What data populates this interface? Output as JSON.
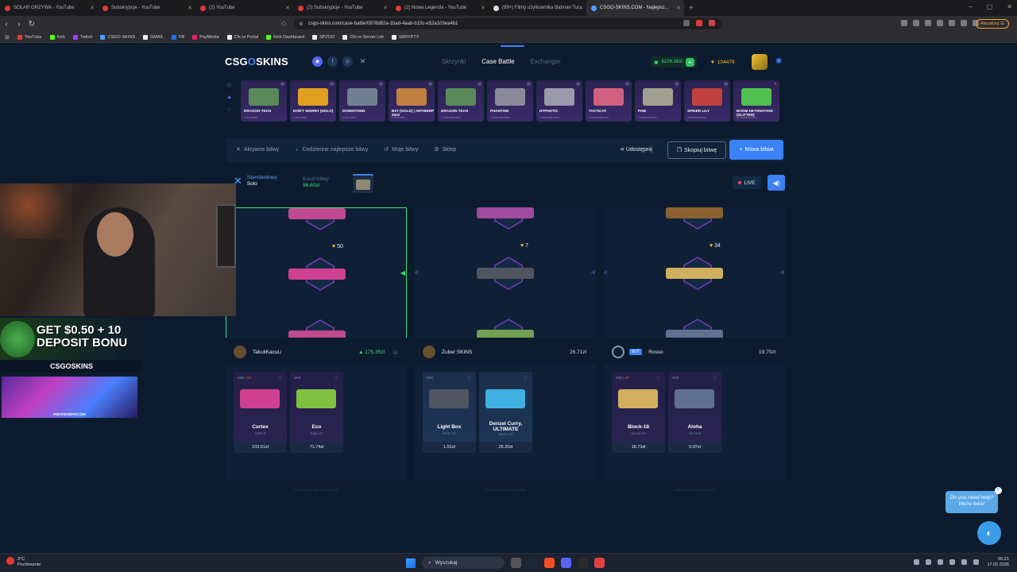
{
  "browser": {
    "tabs": [
      {
        "title": "SOLAR GRZYWA - YouTube",
        "icon": "youtube-icon",
        "active": false
      },
      {
        "title": "Subskrypcje - YouTube",
        "icon": "youtube-icon",
        "active": false
      },
      {
        "title": "(2) YouTube",
        "icon": "youtube-icon",
        "active": false
      },
      {
        "title": "(2) Subskrypcje - YouTube",
        "icon": "youtube-icon",
        "active": false
      },
      {
        "title": "(2) Nowa Legenda - YouTube",
        "icon": "youtube-icon",
        "active": false
      },
      {
        "title": "(99+) Filmy użytkownika Batman Tur...",
        "icon": "github-icon",
        "active": false
      },
      {
        "title": "CSGO-SKINS.COM - Najlepsz...",
        "icon": "csgo-skins-icon",
        "active": true
      }
    ],
    "url": "csgo-skins.com/case-battle/0978d82a-1bad-4aab-b15c-e52a103ea4b1",
    "update_label": "Aktualizuj",
    "bookmarks": [
      "YouTube",
      "Kick",
      "Twitch",
      "CSGO-SKINS",
      "GMAIL",
      "FB",
      "PayMedia",
      "Cfx.re Portal",
      "Kick Dashboard",
      "SPZOO",
      "Cfx.re Server List",
      "SKRYPTY"
    ]
  },
  "site": {
    "logo_left": "CSG",
    "logo_o": "O",
    "logo_right": "SKINS",
    "nav": {
      "cases": "Skrzynki",
      "battle": "Case Battle",
      "exchanger": "Exchanger"
    },
    "balance": "6226.16zł",
    "coins": "104479"
  },
  "drops": [
    {
      "name": "DRAGON TECH",
      "sub": "u tej chwili",
      "color": "#5a8a5a"
    },
    {
      "name": "DON'T WORRY (HOLO)",
      "sub": "u tej chwili",
      "color": "#e0a020"
    },
    {
      "name": "DOWNTOWN",
      "sub": "u tej chwili",
      "color": "#708090"
    },
    {
      "name": "B1T (GOLD) | ANTWERP 2022",
      "sub": "u tej chwili",
      "color": "#c08040"
    },
    {
      "name": "DRAGON TECH",
      "sub": "1 sekundy temu",
      "color": "#5a8a5a"
    },
    {
      "name": "PHANTOM",
      "sub": "3 sekundy temu",
      "color": "#8a8a9a"
    },
    {
      "name": "HYPNOTIC",
      "sub": "3 sekundy temu",
      "color": "#9a9aaa"
    },
    {
      "name": "TACTICAT",
      "sub": "4 sekundy temu",
      "color": "#d06080"
    },
    {
      "name": "PAW",
      "sub": "7 sekund temu",
      "color": "#a0a090"
    },
    {
      "name": "SPIDER LILY",
      "sub": "9 sekund temu",
      "color": "#c04040"
    },
    {
      "name": "BOOM DETONATION (GLITTER)",
      "sub": "12 sekund temu",
      "color": "#50c050"
    }
  ],
  "battle_nav": {
    "active": "Aktywne bitwy",
    "daily": "Codzienne najlepsze bitwy",
    "mine": "Moje bitwy",
    "shop": "Sklep",
    "share": "Udostępnij",
    "copy": "Skopiuj bitwę",
    "new": "Nowa bitwa"
  },
  "battle_info": {
    "mode": "Standardowy",
    "type": "Solo",
    "cost_label": "Koszt bitwy",
    "cost_value": "96.60zł",
    "live": "LIVE"
  },
  "spinners": [
    {
      "coins": "50",
      "winner": true
    },
    {
      "coins": "7",
      "winner": false
    },
    {
      "coins": "34",
      "winner": false
    }
  ],
  "players": [
    {
      "name": "TakuliKacuLi",
      "value": "175.35zł",
      "bot": false,
      "winner": true,
      "items": [
        {
          "wear": "MW",
          "stat": "ST",
          "name": "Cortex",
          "sub": "USP-S",
          "price": "103.61zł",
          "color": "#d04090"
        },
        {
          "wear": "WW",
          "stat": "",
          "name": "Eco",
          "sub": "Galil AR",
          "price": "71.74zł",
          "color": "#80c040"
        }
      ]
    },
    {
      "name": "Żuber SKINS",
      "value": "26.71zł",
      "bot": false,
      "winner": false,
      "items": [
        {
          "wear": "MW",
          "stat": "",
          "name": "Light Box",
          "sub": "MAC-10",
          "price": "1.51zł",
          "color": "#505560"
        },
        {
          "wear": "",
          "stat": "",
          "name": "Denzel Curry, ULTIMATE",
          "sub": "Music Kit",
          "price": "25.20zł",
          "color": "#40b0e0"
        }
      ]
    },
    {
      "name": "Rosso",
      "value": "19.70zł",
      "bot": true,
      "bot_label": "BOT",
      "winner": false,
      "items": [
        {
          "wear": "MW",
          "stat": "ST",
          "name": "Block-18",
          "sub": "Glock-18",
          "price": "18.73zł",
          "color": "#d0b060"
        },
        {
          "wear": "WW",
          "stat": "",
          "name": "Aloha",
          "sub": "SG 553",
          "price": "0.97zł",
          "color": "#607090"
        }
      ]
    }
  ],
  "seeds": [
    "Client seed: TkN7N4GxdtMv",
    "Client seed: 27Ea02d1201",
    "Client seed: 27Ea02d1201"
  ],
  "overlay": {
    "promo": "GET $0.50 + 10 DEPOSIT BONU",
    "brand": "CSGOSKINS",
    "pirate": "PIRATESWAP.COM"
  },
  "help": {
    "line1": "Do you need help?",
    "line2": "We're here!"
  },
  "taskbar": {
    "temp": "3°C",
    "weather": "Pochmurnie",
    "search": "Wyszukaj",
    "time": "00:21",
    "date": "17.02.2026"
  }
}
